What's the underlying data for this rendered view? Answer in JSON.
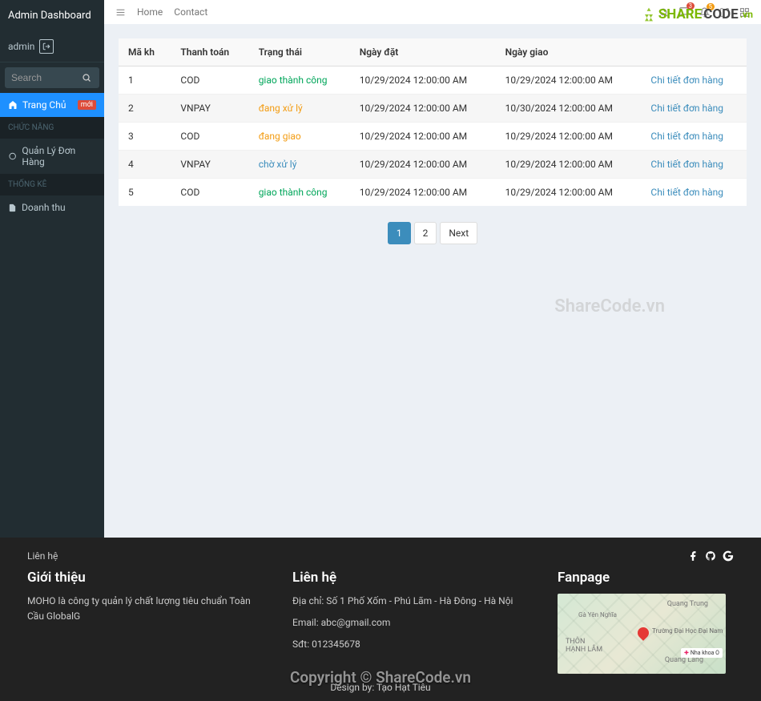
{
  "sidebar": {
    "title": "Admin Dashboard",
    "user": "admin",
    "search_placeholder": "Search",
    "nav_home": "Trang Chủ",
    "badge_new": "mới",
    "header1": "CHỨC NĂNG",
    "nav_orders": "Quản Lý Đơn Hàng",
    "header2": "Thống kê",
    "nav_revenue": "Doanh thu"
  },
  "topbar": {
    "home": "Home",
    "contact": "Contact",
    "badge1": "3",
    "badge2": "5"
  },
  "table": {
    "headers": {
      "col1": "Mã kh",
      "col2": "Thanh toán",
      "col3": "Trạng thái",
      "col4": "Ngày đặt",
      "col5": "Ngày giao",
      "col6": ""
    },
    "rows": [
      {
        "id": "1",
        "pay": "COD",
        "status": "giao thành công",
        "status_cls": "st-success",
        "date1": "10/29/2024 12:00:00 AM",
        "date2": "10/29/2024 12:00:00 AM",
        "link": "Chi tiết đơn hàng"
      },
      {
        "id": "2",
        "pay": "VNPAY",
        "status": "đang xử lý",
        "status_cls": "st-warn",
        "date1": "10/29/2024 12:00:00 AM",
        "date2": "10/30/2024 12:00:00 AM",
        "link": "Chi tiết đơn hàng"
      },
      {
        "id": "3",
        "pay": "COD",
        "status": "đang giao",
        "status_cls": "st-warn",
        "date1": "10/29/2024 12:00:00 AM",
        "date2": "10/29/2024 12:00:00 AM",
        "link": "Chi tiết đơn hàng"
      },
      {
        "id": "4",
        "pay": "VNPAY",
        "status": "chờ xử lý",
        "status_cls": "st-info",
        "date1": "10/29/2024 12:00:00 AM",
        "date2": "10/29/2024 12:00:00 AM",
        "link": "Chi tiết đơn hàng"
      },
      {
        "id": "5",
        "pay": "COD",
        "status": "giao thành công",
        "status_cls": "st-success",
        "date1": "10/29/2024 12:00:00 AM",
        "date2": "10/29/2024 12:00:00 AM",
        "link": "Chi tiết đơn hàng"
      }
    ]
  },
  "pagination": {
    "p1": "1",
    "p2": "2",
    "next": "Next"
  },
  "watermark": {
    "logo1": "SHARE",
    "logo2": "CODE",
    "logo3": ".vn",
    "center": "ShareCode.vn"
  },
  "footer": {
    "contact_label": "Liên hệ",
    "intro_title": "Giới thiệu",
    "intro_text": "MOHO là công ty quản lý chất lượng tiêu chuẩn Toàn Cầu GlobalG",
    "contact_title": "Liên hệ",
    "address": "Địa chỉ: Số 1 Phố Xốm - Phú Lãm - Hà Đông - Hà Nội",
    "email": "Email: abc@gmail.com",
    "phone": "Sđt: 012345678",
    "fanpage_title": "Fanpage",
    "map_t1": "Quang Trung",
    "map_t2": "Quang Làng",
    "map_t3": "THÔN\nHẠNH LÂM",
    "map_t4": "Gà Yên Nghĩa",
    "map_t5": "Trường Đại Học Đại Nam",
    "map_poi": "Nha khoa O",
    "design": "Design by: Tạo Hạt Tiêu",
    "copyright": "Copyright © ShareCode.vn"
  }
}
